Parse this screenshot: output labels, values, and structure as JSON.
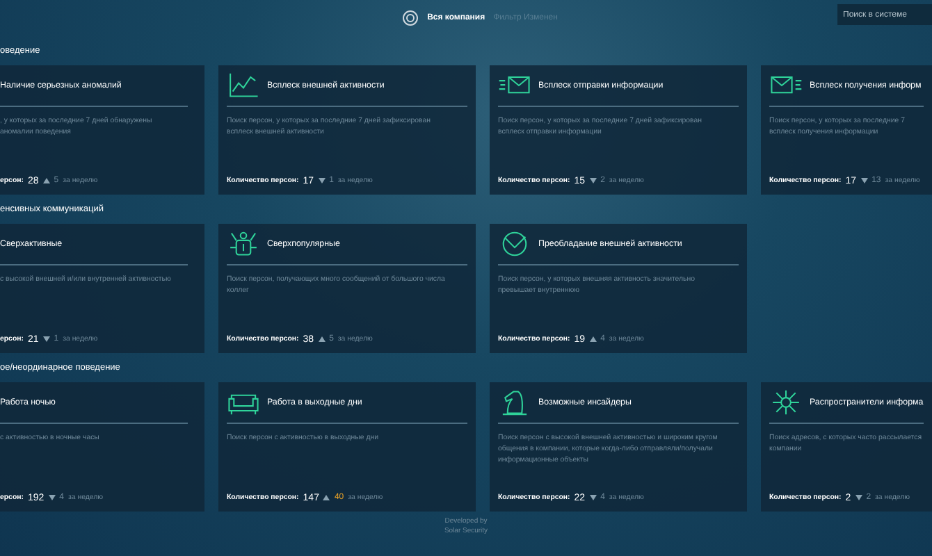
{
  "top_bar": {
    "scope": "Вся компания",
    "filter": "Фильтр Изменен",
    "search": {
      "placeholder": "Поиск в системе"
    }
  },
  "sections": [
    {
      "title": "оведение",
      "cards": [
        {
          "title": "Наличие серьезных аномалий",
          "description": [
            ", у которых за последние 7 дней обнаружены",
            "аномалии поведения"
          ],
          "count_label": "ерсон:",
          "count": "28",
          "rising": true,
          "change": "5",
          "highlight": false,
          "period": "за неделю"
        },
        {
          "title": "Всплеск внешней активности",
          "kind": "chart",
          "description": [
            "Поиск персон, у которых за последние 7 дней зафиксирован",
            "всплеск внешней активности"
          ],
          "count_label": "Количество персон:",
          "count": "17",
          "rising": false,
          "change": "1",
          "highlight": false,
          "period": "за неделю"
        },
        {
          "title": "Всплеск отправки информации",
          "kind": "mail-out",
          "description": [
            "Поиск персон, у которых за последние 7 дней зафиксирован",
            "всплеск отправки информации"
          ],
          "count_label": "Количество персон:",
          "count": "15",
          "rising": false,
          "change": "2",
          "highlight": false,
          "period": "за неделю"
        },
        {
          "title": "Всплеск получения информ",
          "kind": "mail-in",
          "description": [
            "Поиск персон, у которых за последние 7",
            "всплеск получения информации"
          ],
          "count_label": "Количество персон:",
          "count": "17",
          "rising": false,
          "change": "13",
          "highlight": false,
          "period": "за неделю"
        }
      ]
    },
    {
      "title": "енсивных коммуникаций",
      "cards": [
        {
          "title": "Сверхактивные",
          "description": [
            "с высокой внешней и/или внутренней активностью"
          ],
          "count_label": "ерсон:",
          "count": "21",
          "rising": false,
          "change": "1",
          "highlight": false,
          "period": "за неделю"
        },
        {
          "title": "Сверхпопулярные",
          "kind": "robot",
          "description": [
            "Поиск персон, получающих много сообщений от большого числа",
            "коллег"
          ],
          "count_label": "Количество персон:",
          "count": "38",
          "rising": true,
          "change": "5",
          "highlight": false,
          "period": "за неделю"
        },
        {
          "title": "Преобладание внешней активности",
          "kind": "gauge",
          "description": [
            "Поиск персон, у которых внешняя активность значительно",
            "превышает внутреннюю"
          ],
          "count_label": "Количество персон:",
          "count": "19",
          "rising": true,
          "change": "4",
          "highlight": false,
          "period": "за неделю"
        }
      ]
    },
    {
      "title": "ое/неординарное поведение",
      "cards": [
        {
          "title": "Работа ночью",
          "description": [
            "с активностью в ночные часы"
          ],
          "count_label": "ерсон:",
          "count": "192",
          "rising": false,
          "change": "4",
          "highlight": false,
          "period": "за неделю"
        },
        {
          "title": "Работа в выходные дни",
          "kind": "sofa",
          "description": [
            "Поиск персон с активностью в выходные дни"
          ],
          "count_label": "Количество персон:",
          "count": "147",
          "rising": true,
          "change": "40",
          "highlight": true,
          "period": "за неделю"
        },
        {
          "title": "Возможные инсайдеры",
          "kind": "horse",
          "description": [
            "Поиск персон с высокой внешней активностью и широким кругом",
            "общения в компании, которые когда-либо отправляли/получали",
            "информационные объекты"
          ],
          "count_label": "Количество персон:",
          "count": "22",
          "rising": false,
          "change": "4",
          "highlight": false,
          "period": "за неделю"
        },
        {
          "title": "Распространители информа",
          "kind": "network",
          "description": [
            "Поиск адресов, с которых часто рассылается",
            "компании"
          ],
          "count_label": "Количество персон:",
          "count": "2",
          "rising": false,
          "change": "2",
          "highlight": false,
          "period": "за неделю"
        }
      ]
    }
  ],
  "footer": [
    "Developed by",
    "Solar Security"
  ]
}
